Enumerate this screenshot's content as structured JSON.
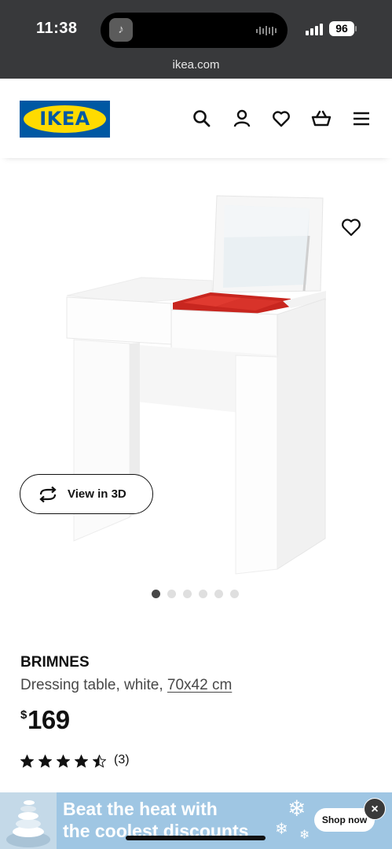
{
  "status_bar": {
    "time": "11:38",
    "battery": "96",
    "url": "ikea.com"
  },
  "header": {
    "logo_text": "IKEA",
    "icons": [
      "search-icon",
      "user-icon",
      "heart-icon",
      "basket-icon",
      "menu-icon"
    ]
  },
  "gallery": {
    "view_3d_label": "View in 3D",
    "dots_total": 6,
    "active_dot": 1
  },
  "product": {
    "name": "BRIMNES",
    "desc_prefix": "Dressing table, white, ",
    "dimensions": "70x42 cm",
    "price_currency": "$",
    "price": "169",
    "rating": 4.5,
    "rating_count": "(3)"
  },
  "ad": {
    "line1": "Beat the heat with",
    "line2": "the coolest discounts",
    "cta": "Shop now",
    "close": "×"
  },
  "colors": {
    "ikea_blue": "#0058a3",
    "ikea_yellow": "#ffdb00",
    "status_bar": "#38393b",
    "ad_bg": "#9fc6e3"
  }
}
